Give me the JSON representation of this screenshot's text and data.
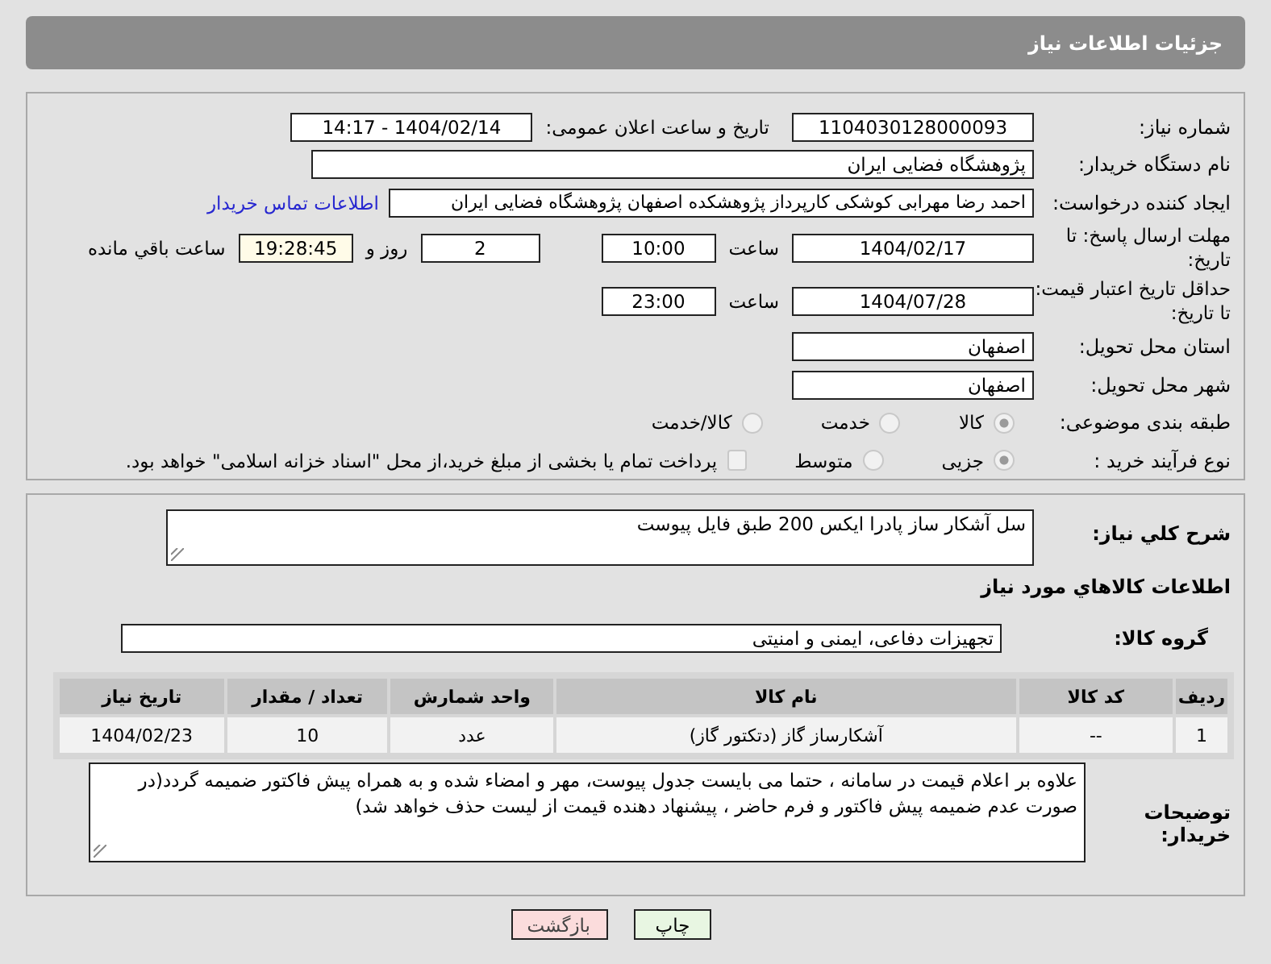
{
  "header": {
    "title": "جزئیات اطلاعات نیاز"
  },
  "details": {
    "need_number": {
      "label": "شماره نیاز:",
      "value": "1104030128000093"
    },
    "announce": {
      "label": "تاریخ و ساعت اعلان عمومی:",
      "value": "1404/02/14 - 14:17"
    },
    "buyer_org": {
      "label": "نام دستگاه خریدار:",
      "value": "پژوهشگاه فضایی ایران"
    },
    "creator": {
      "label": "ایجاد کننده درخواست:",
      "value": "احمد رضا مهرابی کوشکی کارپرداز پژوهشکده اصفهان پژوهشگاه فضایی ایران",
      "link": "اطلاعات تماس خریدار"
    },
    "deadline": {
      "label": "مهلت ارسال پاسخ: تا تاریخ:",
      "date": "1404/02/17",
      "time_label": "ساعت",
      "time": "10:00",
      "days": "2",
      "days_label": "روز و",
      "remaining": "19:28:45",
      "remaining_label": "ساعت باقي مانده"
    },
    "price_validity": {
      "label": "حداقل تاریخ اعتبار قیمت: تا تاریخ:",
      "date": "1404/07/28",
      "time_label": "ساعت",
      "time": "23:00"
    },
    "province": {
      "label": "استان محل تحویل:",
      "value": "اصفهان"
    },
    "city": {
      "label": "شهر محل تحویل:",
      "value": "اصفهان"
    },
    "category": {
      "label": "طبقه بندی موضوعی:",
      "options": [
        {
          "label": "کالا",
          "selected": true
        },
        {
          "label": "خدمت",
          "selected": false
        },
        {
          "label": "کالا/خدمت",
          "selected": false
        }
      ]
    },
    "process": {
      "label": "نوع فرآیند خرید :",
      "options": [
        {
          "label": "جزیی",
          "selected": true
        },
        {
          "label": "متوسط",
          "selected": false
        }
      ],
      "treasury": {
        "label": "پرداخت تمام یا بخشی از مبلغ خرید،از محل \"اسناد خزانه اسلامی\" خواهد بود.",
        "checked": false
      }
    }
  },
  "goods": {
    "description": {
      "label": "شرح کلي نياز:",
      "value": "سل آشکار ساز پادرا ایکس 200 طبق فایل پیوست"
    },
    "title": "اطلاعات کالاهاي مورد نياز",
    "group": {
      "label": "گروه کالا:",
      "value": "تجهیزات دفاعی، ایمنی و امنیتی"
    },
    "table": {
      "columns": [
        "رديف",
        "کد کالا",
        "نام کالا",
        "واحد شمارش",
        "تعداد / مقدار",
        "تاریخ نیاز"
      ],
      "rows": [
        [
          "1",
          "--",
          "آشکارساز گاز (دتکتور گاز)",
          "عدد",
          "10",
          "1404/02/23"
        ]
      ]
    },
    "notes": {
      "label": "توضیحات خریدار:",
      "value": "علاوه بر اعلام قیمت در سامانه ، حتما می بایست جدول پیوست، مهر و امضاء شده و به همراه پیش فاکتور ضمیمه گردد(در صورت عدم ضمیمه پیش فاکتور و فرم حاضر ، پیشنهاد دهنده قیمت از لیست حذف خواهد شد)"
    }
  },
  "buttons": [
    {
      "label": "چاپ",
      "kind": "print"
    },
    {
      "label": "بازگشت",
      "kind": "back"
    }
  ]
}
